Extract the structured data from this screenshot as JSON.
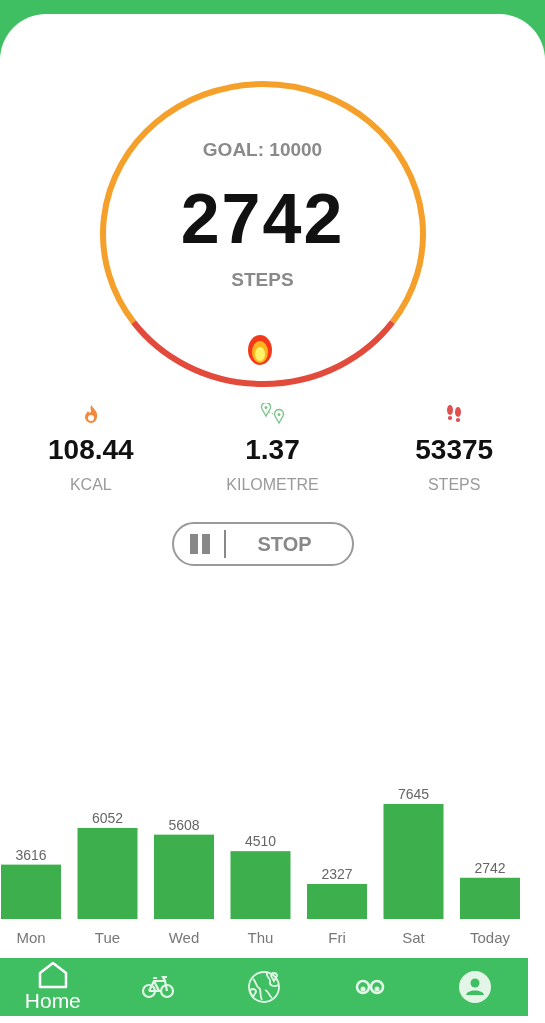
{
  "goal": {
    "label": "GOAL: 10000",
    "count": "2742",
    "unit": "STEPS"
  },
  "stats": [
    {
      "value": "108.44",
      "label": "KCAL"
    },
    {
      "value": "1.37",
      "label": "KILOMETRE"
    },
    {
      "value": "53375",
      "label": "STEPS"
    }
  ],
  "stop_button": {
    "label": "STOP"
  },
  "chart_data": {
    "type": "bar",
    "categories": [
      "Mon",
      "Tue",
      "Wed",
      "Thu",
      "Fri",
      "Sat",
      "Today"
    ],
    "values": [
      3616,
      6052,
      5608,
      4510,
      2327,
      7645,
      2742
    ],
    "data_labels": true
  },
  "nav": [
    {
      "label": "Home",
      "selected": true
    },
    {
      "selected": false
    },
    {
      "selected": false
    },
    {
      "selected": false
    },
    {
      "selected": false
    }
  ]
}
